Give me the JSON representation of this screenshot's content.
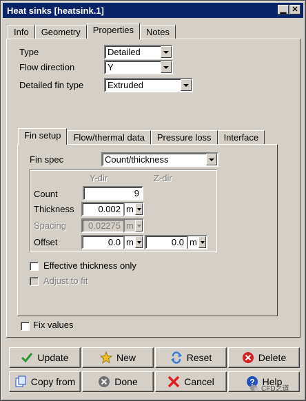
{
  "window": {
    "title": "Heat sinks [heatsink.1]",
    "min_glyph": "▁",
    "close_glyph": "✕"
  },
  "top_tabs": [
    {
      "label": "Info"
    },
    {
      "label": "Geometry"
    },
    {
      "label": "Properties",
      "active": true
    },
    {
      "label": "Notes"
    }
  ],
  "properties": {
    "type_label": "Type",
    "type_value": "Detailed",
    "flow_label": "Flow direction",
    "flow_value": "Y",
    "fin_label": "Detailed fin type",
    "fin_value": "Extruded"
  },
  "inner_tabs": [
    {
      "label": "Fin setup",
      "active": true
    },
    {
      "label": "Flow/thermal data"
    },
    {
      "label": "Pressure loss"
    },
    {
      "label": "Interface"
    }
  ],
  "fin_setup": {
    "spec_label": "Fin spec",
    "spec_value": "Count/thickness",
    "col_y": "Y-dir",
    "col_z": "Z-dir",
    "count_label": "Count",
    "count_y": "9",
    "thickness_label": "Thickness",
    "thickness_y": "0.002",
    "thickness_unit": "m",
    "spacing_label": "Spacing",
    "spacing_y": "0.02275",
    "spacing_unit": "m",
    "offset_label": "Offset",
    "offset_y": "0.0",
    "offset_y_unit": "m",
    "offset_z": "0.0",
    "offset_z_unit": "m",
    "effective_label": "Effective thickness only",
    "effective_checked": false,
    "adjust_label": "Adjust to fit",
    "adjust_checked": false
  },
  "fix_values": {
    "label": "Fix values",
    "checked": false
  },
  "buttons": {
    "update": "Update",
    "new": "New",
    "reset": "Reset",
    "delete": "Delete",
    "copy_from": "Copy from",
    "done": "Done",
    "cancel": "Cancel",
    "help": "Help"
  },
  "watermark": {
    "text": "CFD之道"
  },
  "colors": {
    "titlebar": "#0a246a",
    "face": "#d4d0c8",
    "update_check": "#2a9a2a",
    "new_star": "#f0c020",
    "reset_arrows": "#3a7bd5",
    "delete_red": "#d02020",
    "cancel_x": "#e02020",
    "help_blue": "#2050c0"
  }
}
